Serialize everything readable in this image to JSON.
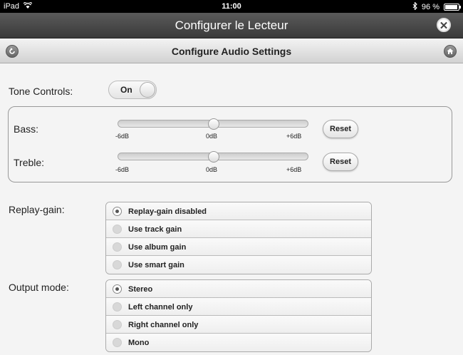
{
  "status": {
    "device": "iPad",
    "time": "11:00",
    "battery": "96 %",
    "battery_level": 0.96
  },
  "titlebar": {
    "title": "Configurer le Lecteur",
    "close_symbol": "✕"
  },
  "header": {
    "title": "Configure Audio Settings"
  },
  "tone": {
    "label": "Tone Controls:",
    "toggle_text": "On"
  },
  "bass": {
    "label": "Bass:",
    "min": "-6dB",
    "mid": "0dB",
    "max": "+6dB",
    "value": 0,
    "reset": "Reset"
  },
  "treble": {
    "label": "Treble:",
    "min": "-6dB",
    "mid": "0dB",
    "max": "+6dB",
    "value": 0,
    "reset": "Reset"
  },
  "replay_gain": {
    "label": "Replay-gain:",
    "options": [
      "Replay-gain disabled",
      "Use track gain",
      "Use album gain",
      "Use smart gain"
    ],
    "selected": 0
  },
  "output_mode": {
    "label": "Output mode:",
    "options": [
      "Stereo",
      "Left channel only",
      "Right channel only",
      "Mono"
    ],
    "selected": 0
  }
}
